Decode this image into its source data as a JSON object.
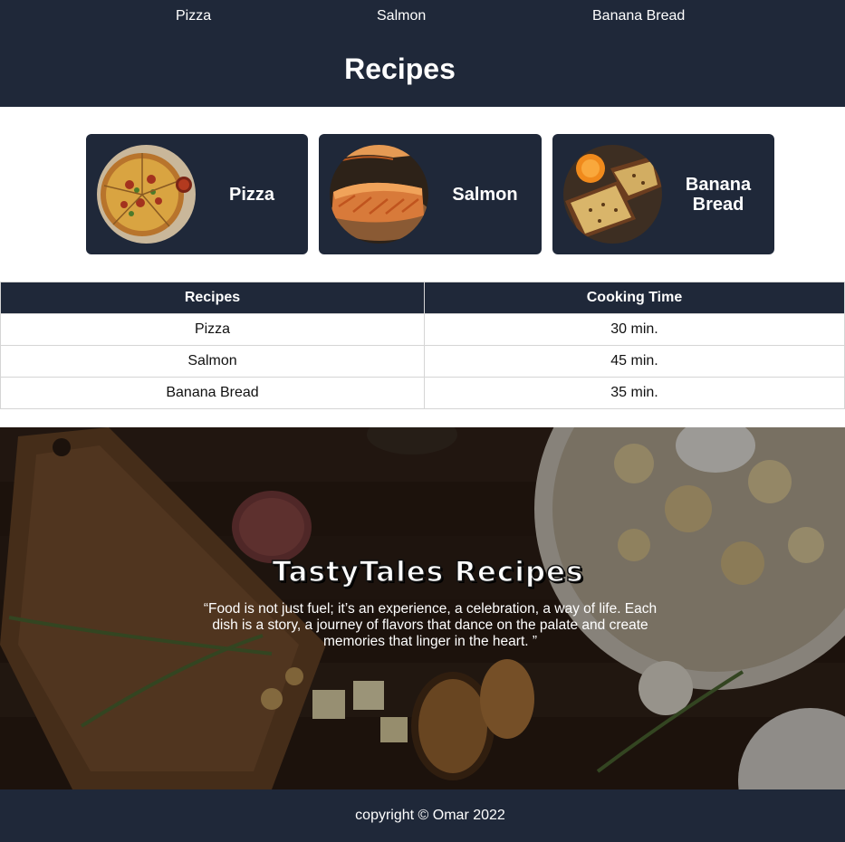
{
  "nav": {
    "items": [
      {
        "label": "Pizza"
      },
      {
        "label": "Salmon"
      },
      {
        "label": "Banana Bread"
      }
    ]
  },
  "header": {
    "title": "Recipes"
  },
  "cards": [
    {
      "title": "Pizza",
      "image": "pizza-photo"
    },
    {
      "title": "Salmon",
      "image": "salmon-photo"
    },
    {
      "title": "Banana Bread",
      "image": "banana-bread-photo"
    }
  ],
  "table": {
    "headers": [
      "Recipes",
      "Cooking Time"
    ],
    "rows": [
      [
        "Pizza",
        "30 min."
      ],
      [
        "Salmon",
        "45 min."
      ],
      [
        "Banana Bread",
        "35 min."
      ]
    ]
  },
  "hero": {
    "title": "TastyTales Recipes",
    "quote": "“Food is not just fuel; it’s an experience, a celebration, a way of life. Each dish is a story, a journey of flavors that dance on the palate and create memories that linger in the heart. ”",
    "image": "food-table-photo"
  },
  "footer": {
    "text": "copyright © Omar 2022"
  },
  "colors": {
    "navy": "#1f2839",
    "white": "#ffffff",
    "border": "#d5d5d5"
  }
}
